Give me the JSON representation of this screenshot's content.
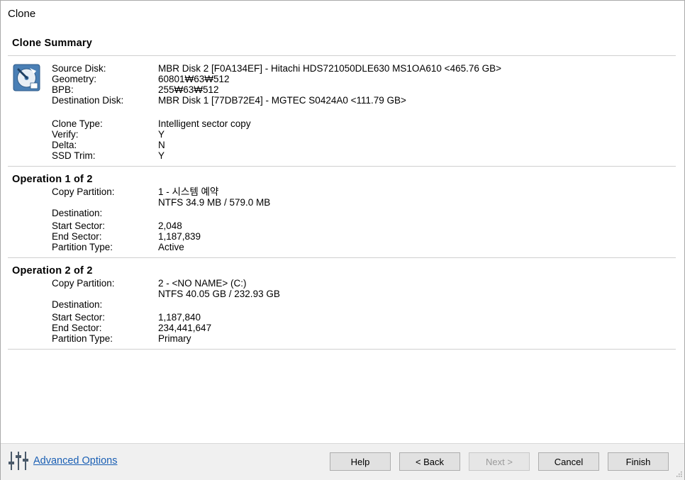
{
  "window": {
    "title": "Clone"
  },
  "summary": {
    "heading": "Clone Summary",
    "rows": [
      {
        "label": "Source Disk:",
        "value": "MBR Disk 2 [F0A134EF] - Hitachi HDS721050DLE630 MS1OA610  <465.76 GB>"
      },
      {
        "label": "Geometry:",
        "value": "60801₩63₩512"
      },
      {
        "label": "BPB:",
        "value": "255₩63₩512"
      },
      {
        "label": "Destination Disk:",
        "value": "MBR Disk 1 [77DB72E4] - MGTEC S0424A0  <111.79 GB>"
      },
      {
        "label": "Clone Type:",
        "value": "Intelligent sector copy"
      },
      {
        "label": "Verify:",
        "value": "Y"
      },
      {
        "label": "Delta:",
        "value": "N"
      },
      {
        "label": "SSD Trim:",
        "value": "Y"
      }
    ]
  },
  "operations": [
    {
      "heading": "Operation 1 of 2",
      "copy_partition_label": "Copy Partition:",
      "copy_partition_value": "1 - 시스템 예약",
      "copy_partition_detail": "NTFS 34.9 MB / 579.0 MB",
      "destination_label": "Destination:",
      "start_sector_label": "Start Sector:",
      "start_sector_value": "2,048",
      "end_sector_label": "End Sector:",
      "end_sector_value": "1,187,839",
      "partition_type_label": "Partition Type:",
      "partition_type_value": "Active"
    },
    {
      "heading": "Operation 2 of 2",
      "copy_partition_label": "Copy Partition:",
      "copy_partition_value": "2 - <NO NAME> (C:)",
      "copy_partition_detail": "NTFS 40.05 GB / 232.93 GB",
      "destination_label": "Destination:",
      "start_sector_label": "Start Sector:",
      "start_sector_value": "1,187,840",
      "end_sector_label": "End Sector:",
      "end_sector_value": "234,441,647",
      "partition_type_label": "Partition Type:",
      "partition_type_value": "Primary"
    }
  ],
  "footer": {
    "advanced_options_label": "Advanced Options",
    "buttons": {
      "help": "Help",
      "back": "< Back",
      "next": "Next >",
      "cancel": "Cancel",
      "finish": "Finish"
    }
  },
  "icons": {
    "disk": "hard-disk-icon",
    "advanced": "sliders-icon",
    "grip": "resize-grip-icon"
  },
  "colors": {
    "link": "#1a5fb4",
    "footer_bg": "#f0f0f0",
    "disk_icon_blue": "#4a7fb5"
  }
}
